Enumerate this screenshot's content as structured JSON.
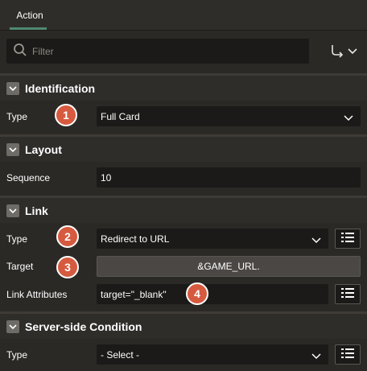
{
  "tabs": [
    {
      "label": "Action"
    }
  ],
  "filter": {
    "placeholder": "Filter"
  },
  "sections": {
    "identification": {
      "title": "Identification",
      "type": {
        "label": "Type",
        "value": "Full Card",
        "badge": "1"
      }
    },
    "layout": {
      "title": "Layout",
      "sequence": {
        "label": "Sequence",
        "value": "10"
      }
    },
    "link": {
      "title": "Link",
      "type": {
        "label": "Type",
        "value": "Redirect to URL",
        "badge": "2"
      },
      "target": {
        "label": "Target",
        "value": "&GAME_URL.",
        "badge": "3"
      },
      "link_attributes": {
        "label": "Link Attributes",
        "value": "target=\"_blank\"",
        "badge": "4"
      }
    },
    "server_side_condition": {
      "title": "Server-side Condition",
      "type": {
        "label": "Type",
        "value": "- Select -"
      }
    }
  },
  "colors": {
    "badge": "#d65a3f",
    "tab_accent": "#4f8a6f",
    "background": "#2b2926"
  }
}
